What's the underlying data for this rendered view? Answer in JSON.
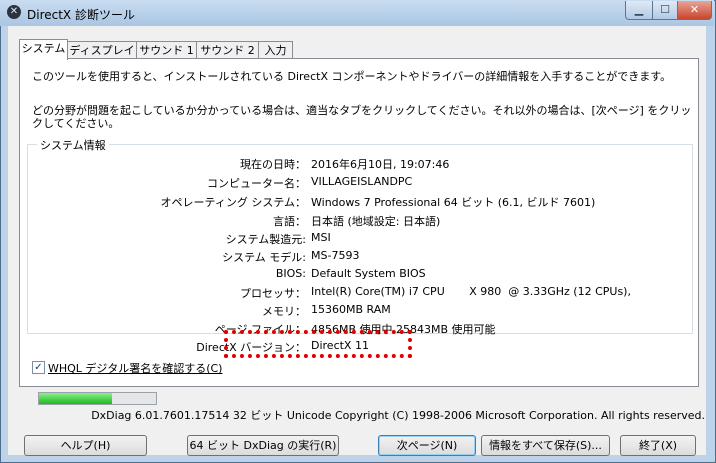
{
  "window": {
    "title": "DirectX 診断ツール",
    "app_icon": "directx-icon",
    "controls": {
      "minimize": "▁",
      "maximize": "☐",
      "close": "✕"
    }
  },
  "tabs": [
    {
      "label": "システム",
      "active": true
    },
    {
      "label": "ディスプレイ"
    },
    {
      "label": "サウンド 1"
    },
    {
      "label": "サウンド 2"
    },
    {
      "label": "入力"
    }
  ],
  "intro": {
    "line1": "このツールを使用すると、インストールされている DirectX コンポーネントやドライバーの詳細情報を入手することができます。",
    "line2": "どの分野が問題を起こしているか分かっている場合は、適当なタブをクリックしてください。それ以外の場合は、[次ページ] をクリックしてください。"
  },
  "system_info": {
    "group_label": "システム情報",
    "rows": [
      {
        "label": "現在の日時：",
        "value": "2016年6月10日, 19:07:46"
      },
      {
        "label": "コンピューター名：",
        "value": "VILLAGEISLANDPC"
      },
      {
        "label": "オペレーティング システム：",
        "value": "Windows 7 Professional 64 ビット (6.1, ビルド 7601)"
      },
      {
        "label": "言語：",
        "value": "日本語 (地域設定: 日本語)"
      },
      {
        "label": "システム製造元:",
        "value": "MSI"
      },
      {
        "label": "システム モデル:",
        "value": "MS-7593"
      },
      {
        "label": "BIOS:",
        "value": "Default System BIOS"
      },
      {
        "label": "プロセッサ：",
        "value": "Intel(R) Core(TM) i7 CPU       X 980  @ 3.33GHz (12 CPUs),"
      },
      {
        "label": "メモリ：",
        "value": "15360MB RAM"
      },
      {
        "label": "ページ ファイル：",
        "value": "4856MB 使用中 25843MB 使用可能"
      },
      {
        "label": "DirectX バージョン：",
        "value": "DirectX 11"
      }
    ]
  },
  "whql_checkbox": {
    "label": "WHQL デジタル署名を確認する(C)",
    "checked": true,
    "mark": "✓"
  },
  "progress": {
    "fraction": 0.62
  },
  "footer": {
    "copyright": "DxDiag 6.01.7601.17514 32 ビット Unicode  Copyright (C) 1998-2006 Microsoft Corporation.  All rights reserved."
  },
  "buttons": {
    "help": "ヘルプ(H)",
    "run64": "64 ビット DxDiag の実行(R)",
    "next": "次ページ(N)",
    "save_all": "情報をすべて保存(S)...",
    "exit": "終了(X)"
  },
  "colors": {
    "highlight_border": "#e00000",
    "progress_fill": "#1fb91f"
  }
}
